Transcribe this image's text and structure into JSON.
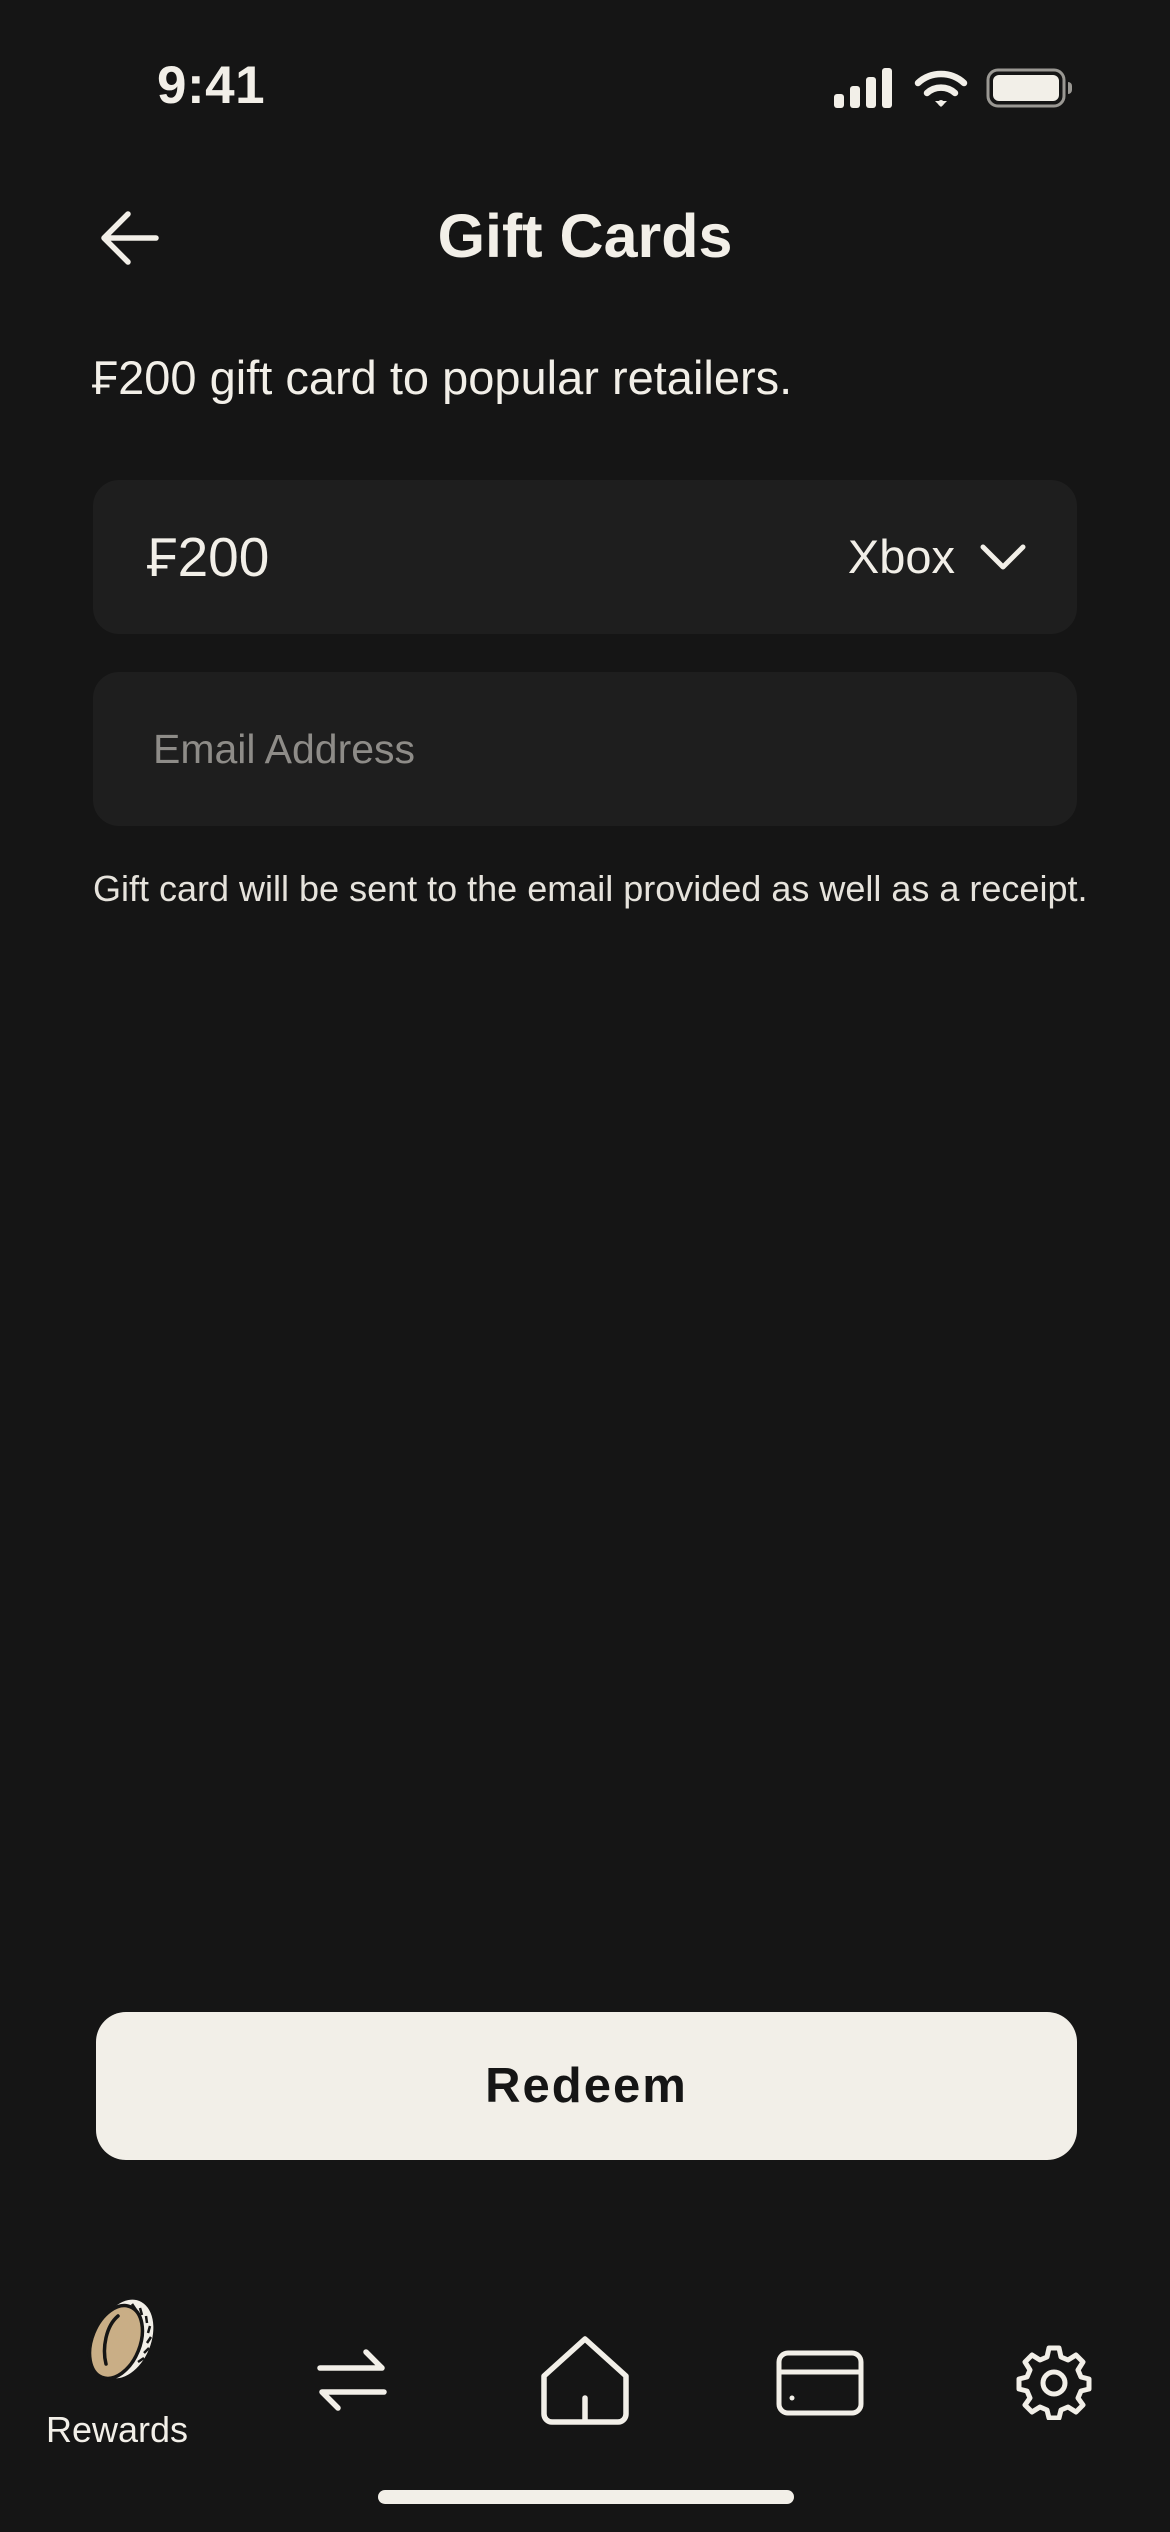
{
  "status_bar": {
    "time": "9:41"
  },
  "header": {
    "title": "Gift Cards",
    "back_icon": "arrow-left-icon"
  },
  "subtitle": "₣200 gift card to popular retailers.",
  "amount_selector": {
    "amount": "₣200",
    "retailer": "Xbox",
    "dropdown_icon": "chevron-down-icon"
  },
  "email_field": {
    "value": "",
    "placeholder": "Email Address"
  },
  "helper_text": "Gift card will be sent to the email provided as well as a receipt.",
  "primary_action": {
    "label": "Redeem"
  },
  "tab_bar": {
    "items": [
      {
        "label": "Rewards",
        "icon": "coin-icon"
      },
      {
        "label": "",
        "icon": "transfer-arrows-icon"
      },
      {
        "label": "",
        "icon": "home-icon"
      },
      {
        "label": "",
        "icon": "card-icon"
      },
      {
        "label": "",
        "icon": "gear-icon"
      }
    ]
  },
  "colors": {
    "background": "#151515",
    "surface": "#1E1E1E",
    "text": "#F2EFE8",
    "placeholder": "#8E8C88",
    "button": "#F2EFE8",
    "button_text": "#151515",
    "coin_fill": "#C9AE86"
  }
}
